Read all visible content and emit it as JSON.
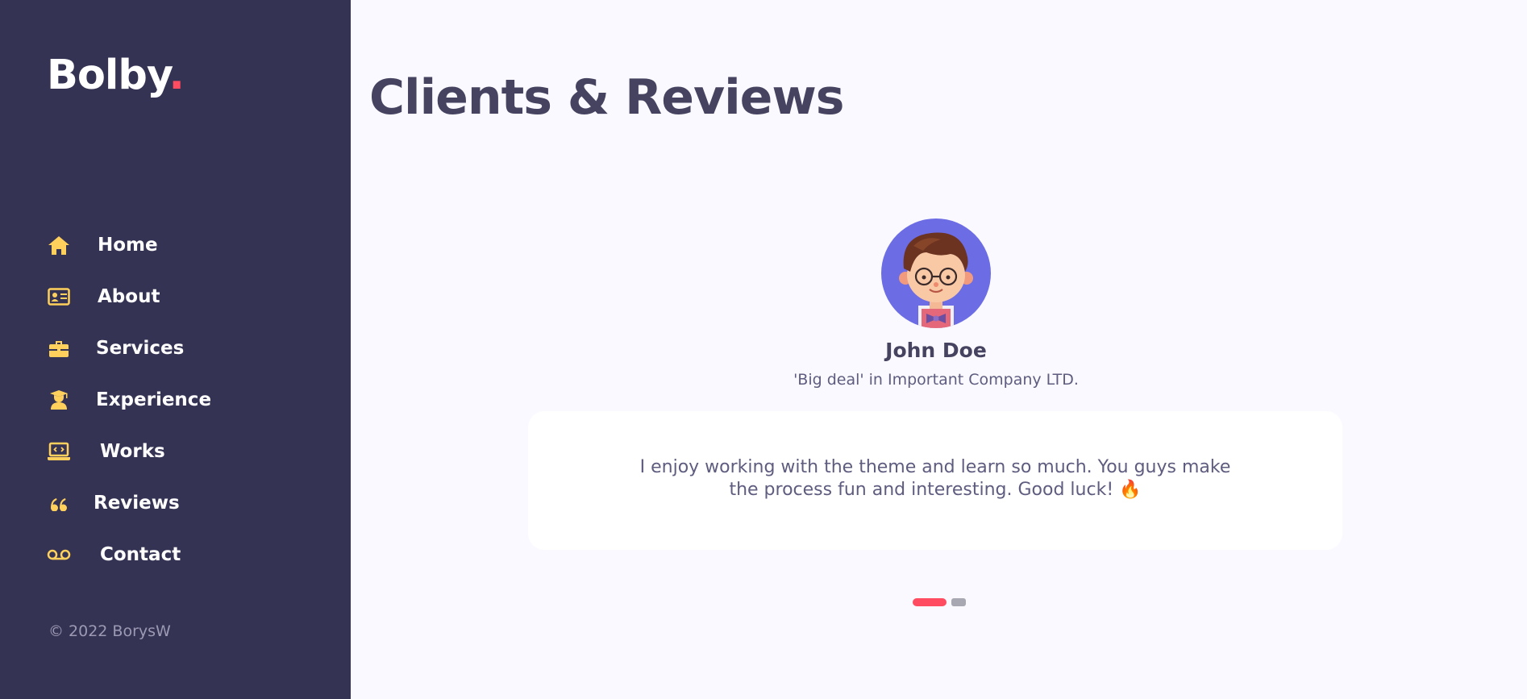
{
  "brand": {
    "name": "Bolby",
    "dot": ".",
    "accent": "#ff4c60"
  },
  "colors": {
    "sidebar": "#353353",
    "icon": "#ffd15c",
    "heading": "#454360",
    "avatar_bg": "#6c6ce5"
  },
  "nav": [
    {
      "label": "Home",
      "icon": "home-icon"
    },
    {
      "label": "About",
      "icon": "id-card-icon"
    },
    {
      "label": "Services",
      "icon": "briefcase-icon"
    },
    {
      "label": "Experience",
      "icon": "graduate-icon"
    },
    {
      "label": "Works",
      "icon": "laptop-code-icon"
    },
    {
      "label": "Reviews",
      "icon": "quote-icon"
    },
    {
      "label": "Contact",
      "icon": "voicemail-icon"
    }
  ],
  "copyright": "© 2022 BorysW",
  "page": {
    "title": "Clients & Reviews"
  },
  "review": {
    "name": "John Doe",
    "role": "'Big deal' in Important Company LTD.",
    "quote_line1": "I enjoy working with the theme and learn so much. You guys make",
    "quote_line2": "the process fun and interesting. Good luck! 🔥"
  },
  "carousel": {
    "total": 2,
    "active": 1
  }
}
